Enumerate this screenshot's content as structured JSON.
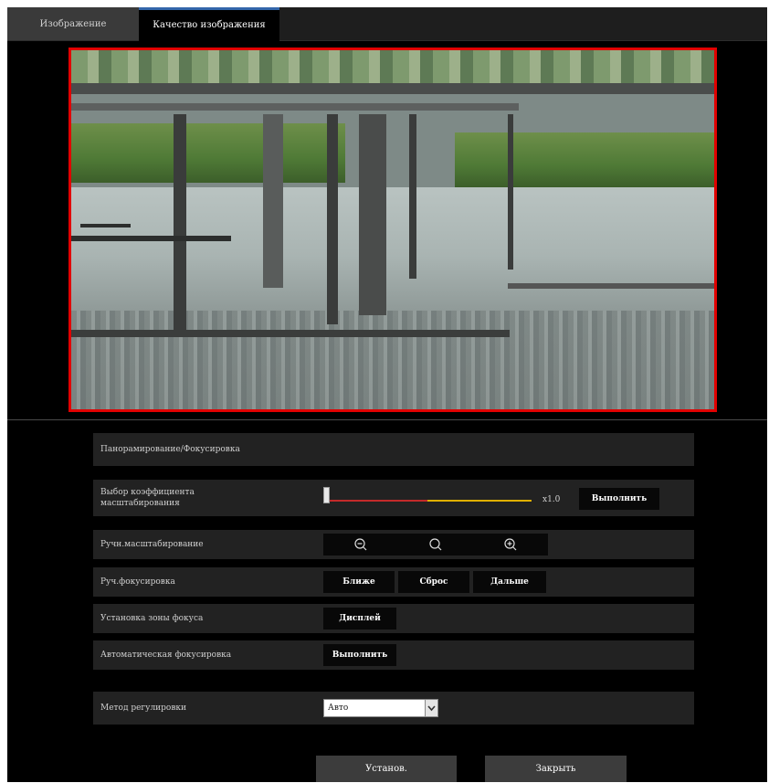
{
  "tabs": [
    {
      "label": "Изображение"
    },
    {
      "label": "Качество изображения"
    }
  ],
  "section_title": "Панорамирование/Фокусировка",
  "zoom_ratio": {
    "label": "Выбор коэффициента масштабирования",
    "value_text": "x1.0",
    "slider_level": 0.0,
    "execute_label": "Выполнить"
  },
  "manual_zoom": {
    "label": "Ручн.масштабирование",
    "icons": [
      "zoom-out-icon",
      "zoom-reset-icon",
      "zoom-in-icon"
    ]
  },
  "manual_focus": {
    "label": "Руч.фокусировка",
    "near_label": "Ближе",
    "reset_label": "Сброс",
    "far_label": "Дальше"
  },
  "focus_area": {
    "label": "Установка зоны фокуса",
    "button_label": "Дисплей"
  },
  "auto_focus": {
    "label": "Автоматическая фокусировка",
    "button_label": "Выполнить"
  },
  "adjust_method": {
    "label": "Метод регулировки",
    "selected": "Авто"
  },
  "footer": {
    "set_label": "Установ.",
    "close_label": "Закрыть"
  },
  "colors": {
    "preview_border": "#e10000",
    "slider_red": "#c42a2a",
    "slider_yellow": "#e0b000"
  }
}
